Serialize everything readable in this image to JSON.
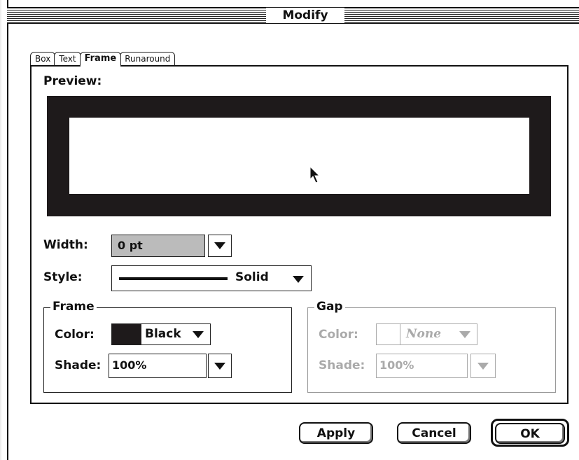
{
  "window": {
    "title": "Modify"
  },
  "tabs": [
    {
      "label": "Box",
      "active": false
    },
    {
      "label": "Text",
      "active": false
    },
    {
      "label": "Frame",
      "active": true
    },
    {
      "label": "Runaround",
      "active": false
    }
  ],
  "preview": {
    "label": "Preview:",
    "frame_color": "#1e1a1b"
  },
  "width": {
    "label": "Width:",
    "value": "0 pt"
  },
  "style": {
    "label": "Style:",
    "value": "Solid"
  },
  "frame_group": {
    "title": "Frame",
    "color_label": "Color:",
    "color_value": "Black",
    "swatch_color": "#1e1a1b",
    "shade_label": "Shade:",
    "shade_value": "100%"
  },
  "gap_group": {
    "title": "Gap",
    "color_label": "Color:",
    "color_value": "None",
    "shade_label": "Shade:",
    "shade_value": "100%",
    "enabled": false
  },
  "buttons": {
    "apply": "Apply",
    "cancel": "Cancel",
    "ok": "OK"
  }
}
